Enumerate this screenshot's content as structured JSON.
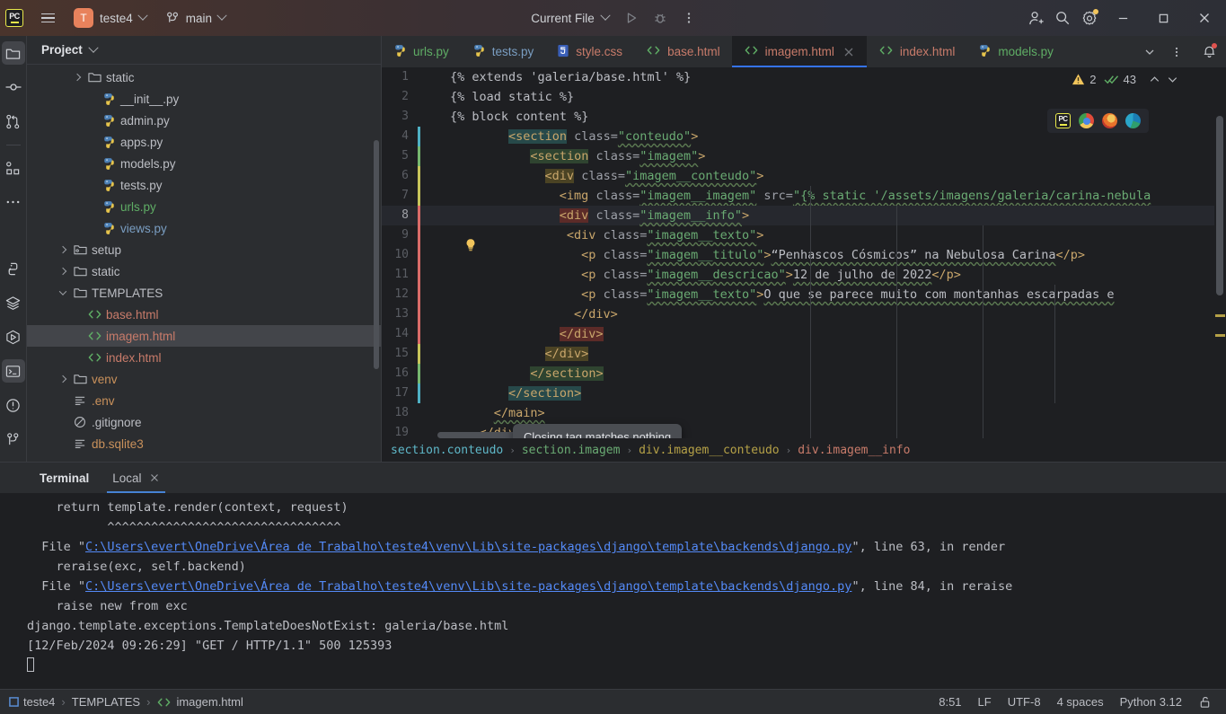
{
  "titlebar": {
    "logo": "pycharm-logo",
    "project_name": "teste4",
    "project_initial": "T",
    "branch": "main",
    "run_config": "Current File",
    "icons": {
      "hamburger": "main-menu-icon",
      "run": "run-icon",
      "debug": "debug-icon",
      "more": "more-options-icon",
      "share": "add-user-icon",
      "search": "search-icon",
      "settings": "settings-gear-icon",
      "minimize": "minimize-icon",
      "maximize": "maximize-icon",
      "close": "close-icon"
    }
  },
  "toolstrip": {
    "top": [
      {
        "name": "project-tool",
        "icon": "folder-icon",
        "active": true
      },
      {
        "name": "commit-tool",
        "icon": "commit-icon",
        "active": false
      },
      {
        "name": "pull-requests-tool",
        "icon": "pull-request-icon",
        "active": false
      },
      {
        "name": "structure-tool",
        "icon": "structure-icon",
        "active": false
      },
      {
        "name": "more-tool-windows",
        "icon": "ellipsis-icon",
        "active": false
      }
    ],
    "bottom": [
      {
        "name": "python-console-tool",
        "icon": "python-icon",
        "active": false
      },
      {
        "name": "services-tool",
        "icon": "layers-icon",
        "active": false
      },
      {
        "name": "run-tool",
        "icon": "play-hex-icon",
        "active": false
      },
      {
        "name": "terminal-tool",
        "icon": "terminal-icon",
        "active": true
      },
      {
        "name": "problems-tool",
        "icon": "warning-circle-icon",
        "active": false
      },
      {
        "name": "git-tool",
        "icon": "branch-icon",
        "active": false
      }
    ]
  },
  "project_panel": {
    "header": "Project",
    "tree": [
      {
        "label": "static",
        "type": "folder",
        "indent": 3,
        "arrow": "closed",
        "color": "#bcbec4",
        "selected": false
      },
      {
        "label": "__init__.py",
        "type": "python",
        "indent": 4,
        "arrow": "none",
        "color": "#bcbec4",
        "selected": false
      },
      {
        "label": "admin.py",
        "type": "python",
        "indent": 4,
        "arrow": "none",
        "color": "#bcbec4",
        "selected": false
      },
      {
        "label": "apps.py",
        "type": "python",
        "indent": 4,
        "arrow": "none",
        "color": "#bcbec4",
        "selected": false
      },
      {
        "label": "models.py",
        "type": "python",
        "indent": 4,
        "arrow": "none",
        "color": "#bcbec4",
        "selected": false
      },
      {
        "label": "tests.py",
        "type": "python",
        "indent": 4,
        "arrow": "none",
        "color": "#bcbec4",
        "selected": false
      },
      {
        "label": "urls.py",
        "type": "python",
        "indent": 4,
        "arrow": "none",
        "color": "#5fad65",
        "selected": false
      },
      {
        "label": "views.py",
        "type": "python",
        "indent": 4,
        "arrow": "none",
        "color": "#7a9ec2",
        "selected": false
      },
      {
        "label": "setup",
        "type": "module",
        "indent": 2,
        "arrow": "closed",
        "color": "#bcbec4",
        "selected": false
      },
      {
        "label": "static",
        "type": "folder",
        "indent": 2,
        "arrow": "closed",
        "color": "#bcbec4",
        "selected": false
      },
      {
        "label": "TEMPLATES",
        "type": "folder",
        "indent": 2,
        "arrow": "open",
        "color": "#bcbec4",
        "selected": false
      },
      {
        "label": "base.html",
        "type": "html",
        "indent": 3,
        "arrow": "none",
        "color": "#c87b6a",
        "selected": false
      },
      {
        "label": "imagem.html",
        "type": "html",
        "indent": 3,
        "arrow": "none",
        "color": "#c87b6a",
        "selected": true
      },
      {
        "label": "index.html",
        "type": "html",
        "indent": 3,
        "arrow": "none",
        "color": "#c87b6a",
        "selected": false
      },
      {
        "label": "venv",
        "type": "folder",
        "indent": 2,
        "arrow": "closed",
        "color": "#c9915b",
        "selected": false
      },
      {
        "label": ".env",
        "type": "text",
        "indent": 2,
        "arrow": "none",
        "color": "#c9915b",
        "selected": false
      },
      {
        "label": ".gitignore",
        "type": "ignore",
        "indent": 2,
        "arrow": "none",
        "color": "#bcbec4",
        "selected": false
      },
      {
        "label": "db.sqlite3",
        "type": "text",
        "indent": 2,
        "arrow": "none",
        "color": "#c9915b",
        "selected": false
      }
    ]
  },
  "editor": {
    "tabs": [
      {
        "label": "urls.py",
        "icon": "python-file-icon",
        "color": "#5fad65",
        "active": false,
        "closable": false
      },
      {
        "label": "tests.py",
        "icon": "python-file-icon",
        "color": "#7a9ec2",
        "active": false,
        "closable": false
      },
      {
        "label": "style.css",
        "icon": "css-file-icon",
        "color": "#c87b6a",
        "active": false,
        "closable": false
      },
      {
        "label": "base.html",
        "icon": "html-file-icon",
        "color": "#c87b6a",
        "active": false,
        "closable": false
      },
      {
        "label": "imagem.html",
        "icon": "html-file-icon",
        "color": "#c87b6a",
        "active": true,
        "closable": true
      },
      {
        "label": "index.html",
        "icon": "html-file-icon",
        "color": "#c87b6a",
        "active": false,
        "closable": false
      },
      {
        "label": "models.py",
        "icon": "python-file-icon",
        "color": "#5fad65",
        "active": false,
        "closable": false
      }
    ],
    "tab_overflow_icon": "chevron-down-icon",
    "tab_options_icon": "more-options-icon",
    "notification_icon": "notifications-bell-icon",
    "inspection": {
      "warning_icon": "warning-triangle-icon",
      "warning_count": "2",
      "ok_icon": "inspections-ok-icon",
      "ok_count": "43",
      "prev_icon": "chevron-up-icon",
      "next_icon": "chevron-down-icon"
    },
    "preview_browsers": [
      {
        "name": "pycharm-preview-icon",
        "label": "PC"
      },
      {
        "name": "chrome-icon",
        "label": ""
      },
      {
        "name": "firefox-icon",
        "label": ""
      },
      {
        "name": "edge-icon",
        "label": ""
      }
    ],
    "tooltip": "Closing tag matches nothing",
    "current_line": 8,
    "lines": [
      {
        "n": 1,
        "indent": 0,
        "stripe": "",
        "segs": [
          {
            "t": "{% extends 'galeria/base.html' %}",
            "c": "dj"
          }
        ]
      },
      {
        "n": 2,
        "indent": 0,
        "stripe": "",
        "segs": [
          {
            "t": "{% load static %}",
            "c": "dj"
          }
        ]
      },
      {
        "n": 3,
        "indent": 0,
        "stripe": "",
        "segs": [
          {
            "t": "{% block content %}",
            "c": "dj"
          }
        ]
      },
      {
        "n": 4,
        "indent": 8,
        "stripe": "#4fb0c4",
        "segs": [
          {
            "t": "<section",
            "c": "tg",
            "hl": "teal"
          },
          {
            "t": " ",
            "c": "tx"
          },
          {
            "t": "class=",
            "c": "at"
          },
          {
            "t": "\"conteudo\"",
            "c": "st",
            "w": 1
          },
          {
            "t": ">",
            "c": "tg"
          }
        ]
      },
      {
        "n": 5,
        "indent": 11,
        "stripe": "#76b76f",
        "segs": [
          {
            "t": "<section",
            "c": "tg",
            "hl": "green"
          },
          {
            "t": " ",
            "c": "tx"
          },
          {
            "t": "class=",
            "c": "at"
          },
          {
            "t": "\"imagem\"",
            "c": "st",
            "w": 1
          },
          {
            "t": ">",
            "c": "tg"
          }
        ]
      },
      {
        "n": 6,
        "indent": 13,
        "stripe": "#c7c45a",
        "segs": [
          {
            "t": "<div",
            "c": "tg",
            "hl": "olive"
          },
          {
            "t": " ",
            "c": "tx"
          },
          {
            "t": "class=",
            "c": "at"
          },
          {
            "t": "\"imagem__conteudo\"",
            "c": "st",
            "w": 1
          },
          {
            "t": ">",
            "c": "tg"
          }
        ]
      },
      {
        "n": 7,
        "indent": 15,
        "stripe": "#c7c45a",
        "segs": [
          {
            "t": "<img",
            "c": "tg"
          },
          {
            "t": " ",
            "c": "tx"
          },
          {
            "t": "class=",
            "c": "at"
          },
          {
            "t": "\"imagem__imagem\"",
            "c": "st",
            "w": 1
          },
          {
            "t": " ",
            "c": "tx"
          },
          {
            "t": "src=",
            "c": "at"
          },
          {
            "t": "\"{% static '/assets/imagens/galeria/carina-nebula",
            "c": "st",
            "w": 1
          }
        ]
      },
      {
        "n": 8,
        "indent": 15,
        "stripe": "#d96c68",
        "segs": [
          {
            "t": "<div",
            "c": "tg",
            "hl": "red"
          },
          {
            "t": " ",
            "c": "tx"
          },
          {
            "t": "class=",
            "c": "at"
          },
          {
            "t": "\"imagem__info\"",
            "c": "st",
            "w": 1
          },
          {
            "t": ">",
            "c": "tg"
          }
        ]
      },
      {
        "n": 9,
        "indent": 16,
        "stripe": "#d96c68",
        "segs": [
          {
            "t": "<div",
            "c": "tg"
          },
          {
            "t": " ",
            "c": "tx"
          },
          {
            "t": "class=",
            "c": "at"
          },
          {
            "t": "\"imagem__texto\"",
            "c": "st",
            "w": 1
          },
          {
            "t": ">",
            "c": "tg"
          }
        ]
      },
      {
        "n": 10,
        "indent": 18,
        "stripe": "#d96c68",
        "segs": [
          {
            "t": "<p",
            "c": "tg"
          },
          {
            "t": " ",
            "c": "tx"
          },
          {
            "t": "class=",
            "c": "at"
          },
          {
            "t": "\"imagem__titulo\"",
            "c": "st",
            "w": 1
          },
          {
            "t": ">",
            "c": "tg"
          },
          {
            "t": "“Penhascos Cósmicos” na Nebulosa Carina",
            "c": "tx",
            "w": 1
          },
          {
            "t": "</p>",
            "c": "tg"
          }
        ]
      },
      {
        "n": 11,
        "indent": 18,
        "stripe": "#d96c68",
        "segs": [
          {
            "t": "<p",
            "c": "tg"
          },
          {
            "t": " ",
            "c": "tx"
          },
          {
            "t": "class=",
            "c": "at"
          },
          {
            "t": "\"imagem__descricao\"",
            "c": "st",
            "w": 1
          },
          {
            "t": ">",
            "c": "tg"
          },
          {
            "t": "12 de julho de 2022",
            "c": "tx",
            "w": 1
          },
          {
            "t": "</p>",
            "c": "tg"
          }
        ]
      },
      {
        "n": 12,
        "indent": 18,
        "stripe": "#d96c68",
        "segs": [
          {
            "t": "<p",
            "c": "tg"
          },
          {
            "t": " ",
            "c": "tx"
          },
          {
            "t": "class=",
            "c": "at"
          },
          {
            "t": "\"imagem__texto\"",
            "c": "st",
            "w": 1
          },
          {
            "t": ">",
            "c": "tg"
          },
          {
            "t": "O que se parece muito com montanhas escarpadas e",
            "c": "tx",
            "w": 1
          }
        ]
      },
      {
        "n": 13,
        "indent": 17,
        "stripe": "#d96c68",
        "segs": [
          {
            "t": "</div>",
            "c": "tg"
          }
        ]
      },
      {
        "n": 14,
        "indent": 15,
        "stripe": "#d96c68",
        "segs": [
          {
            "t": "</div>",
            "c": "tg",
            "hl": "red"
          }
        ]
      },
      {
        "n": 15,
        "indent": 13,
        "stripe": "#c7c45a",
        "segs": [
          {
            "t": "</div>",
            "c": "tg",
            "hl": "olive"
          }
        ]
      },
      {
        "n": 16,
        "indent": 11,
        "stripe": "#76b76f",
        "segs": [
          {
            "t": "</section>",
            "c": "tg",
            "hl": "green"
          }
        ]
      },
      {
        "n": 17,
        "indent": 8,
        "stripe": "#4fb0c4",
        "segs": [
          {
            "t": "</section>",
            "c": "tg",
            "hl": "teal"
          }
        ]
      },
      {
        "n": 18,
        "indent": 6,
        "stripe": "",
        "segs": [
          {
            "t": "</main>",
            "c": "tg",
            "w": 1
          }
        ]
      },
      {
        "n": 19,
        "indent": 4,
        "stripe": "",
        "segs": [
          {
            "t": "</div>",
            "c": "tg",
            "w": 1
          }
        ]
      }
    ],
    "breadcrumbs": [
      {
        "label": "section.conteudo",
        "color": "#5fb8c9"
      },
      {
        "label": "section.imagem",
        "color": "#6aab73"
      },
      {
        "label": "div.imagem__conteudo",
        "color": "#b5a147"
      },
      {
        "label": "div.imagem__info",
        "color": "#c87b6a"
      }
    ]
  },
  "terminal": {
    "title": "Terminal",
    "tab": "Local",
    "close_icon": "close-icon",
    "lines": [
      [
        {
          "t": "    return template.render(context, request)",
          "c": "plain"
        }
      ],
      [
        {
          "t": "           ^^^^^^^^^^^^^^^^^^^^^^^^^^^^^^^^",
          "c": "plain"
        }
      ],
      [
        {
          "t": "  File \"",
          "c": "plain"
        },
        {
          "t": "C:\\Users\\evert\\OneDrive\\Área de Trabalho\\teste4\\venv\\Lib\\site-packages\\django\\template\\backends\\django.py",
          "c": "link"
        },
        {
          "t": "\", line 63, in render",
          "c": "plain"
        }
      ],
      [
        {
          "t": "    reraise(exc, self.backend)",
          "c": "plain"
        }
      ],
      [
        {
          "t": "  File \"",
          "c": "plain"
        },
        {
          "t": "C:\\Users\\evert\\OneDrive\\Área de Trabalho\\teste4\\venv\\Lib\\site-packages\\django\\template\\backends\\django.py",
          "c": "link"
        },
        {
          "t": "\", line 84, in reraise",
          "c": "plain"
        }
      ],
      [
        {
          "t": "    raise new from exc",
          "c": "plain"
        }
      ],
      [
        {
          "t": "django.template.exceptions.TemplateDoesNotExist: galeria/base.html",
          "c": "plain"
        }
      ],
      [
        {
          "t": "[12/Feb/2024 09:26:29] \"GET / HTTP/1.1\" 500 125393",
          "c": "plain"
        }
      ]
    ]
  },
  "statusbar": {
    "breadcrumb": [
      {
        "label": "teste4",
        "icon": "module-icon"
      },
      {
        "label": "TEMPLATES",
        "icon": ""
      },
      {
        "label": "imagem.html",
        "icon": "html-file-icon"
      }
    ],
    "caret_position": "8:51",
    "line_separator": "LF",
    "encoding": "UTF-8",
    "indent": "4 spaces",
    "interpreter": "Python 3.12",
    "lock_icon": "unlocked-icon"
  },
  "colors": {
    "accent": "#3573f0",
    "bg_editor": "#1e1f22",
    "bg_panel": "#2b2d30",
    "warning": "#f2c55c",
    "error": "#e0534f"
  }
}
